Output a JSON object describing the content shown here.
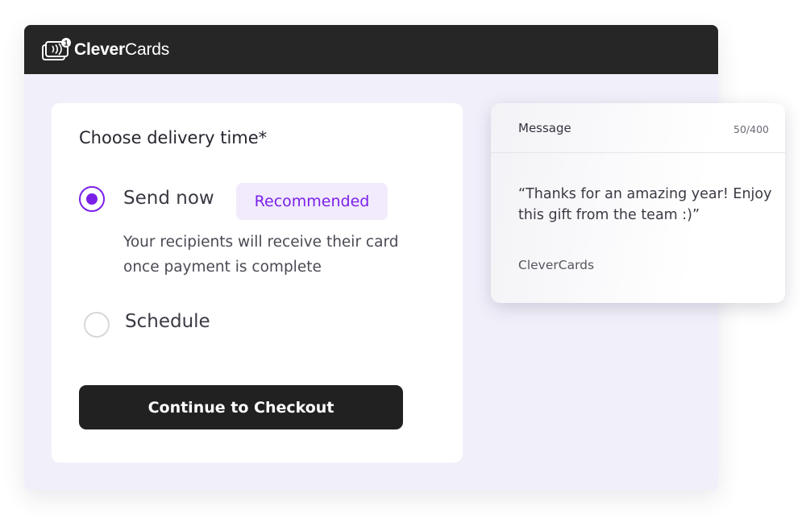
{
  "app": {
    "brand_bold": "Clever",
    "brand_light": "Cards",
    "logo_badge": "1"
  },
  "delivery": {
    "title": "Choose delivery time*",
    "options": [
      {
        "label": "Send now",
        "selected": true,
        "badge": "Recommended",
        "description": "Your recipients will receive their card once payment is complete"
      },
      {
        "label": "Schedule",
        "selected": false
      }
    ],
    "checkout_label": "Continue to Checkout"
  },
  "message": {
    "label": "Message",
    "count": "50/400",
    "body": "“Thanks for an amazing year! Enjoy this gift from the team :)”",
    "signature": "CleverCards"
  },
  "colors": {
    "accent": "#7b1fe8",
    "accent_soft": "#f1ebfd",
    "titlebar": "#262626",
    "window_bg": "#f1f0fa",
    "button": "#212121"
  }
}
